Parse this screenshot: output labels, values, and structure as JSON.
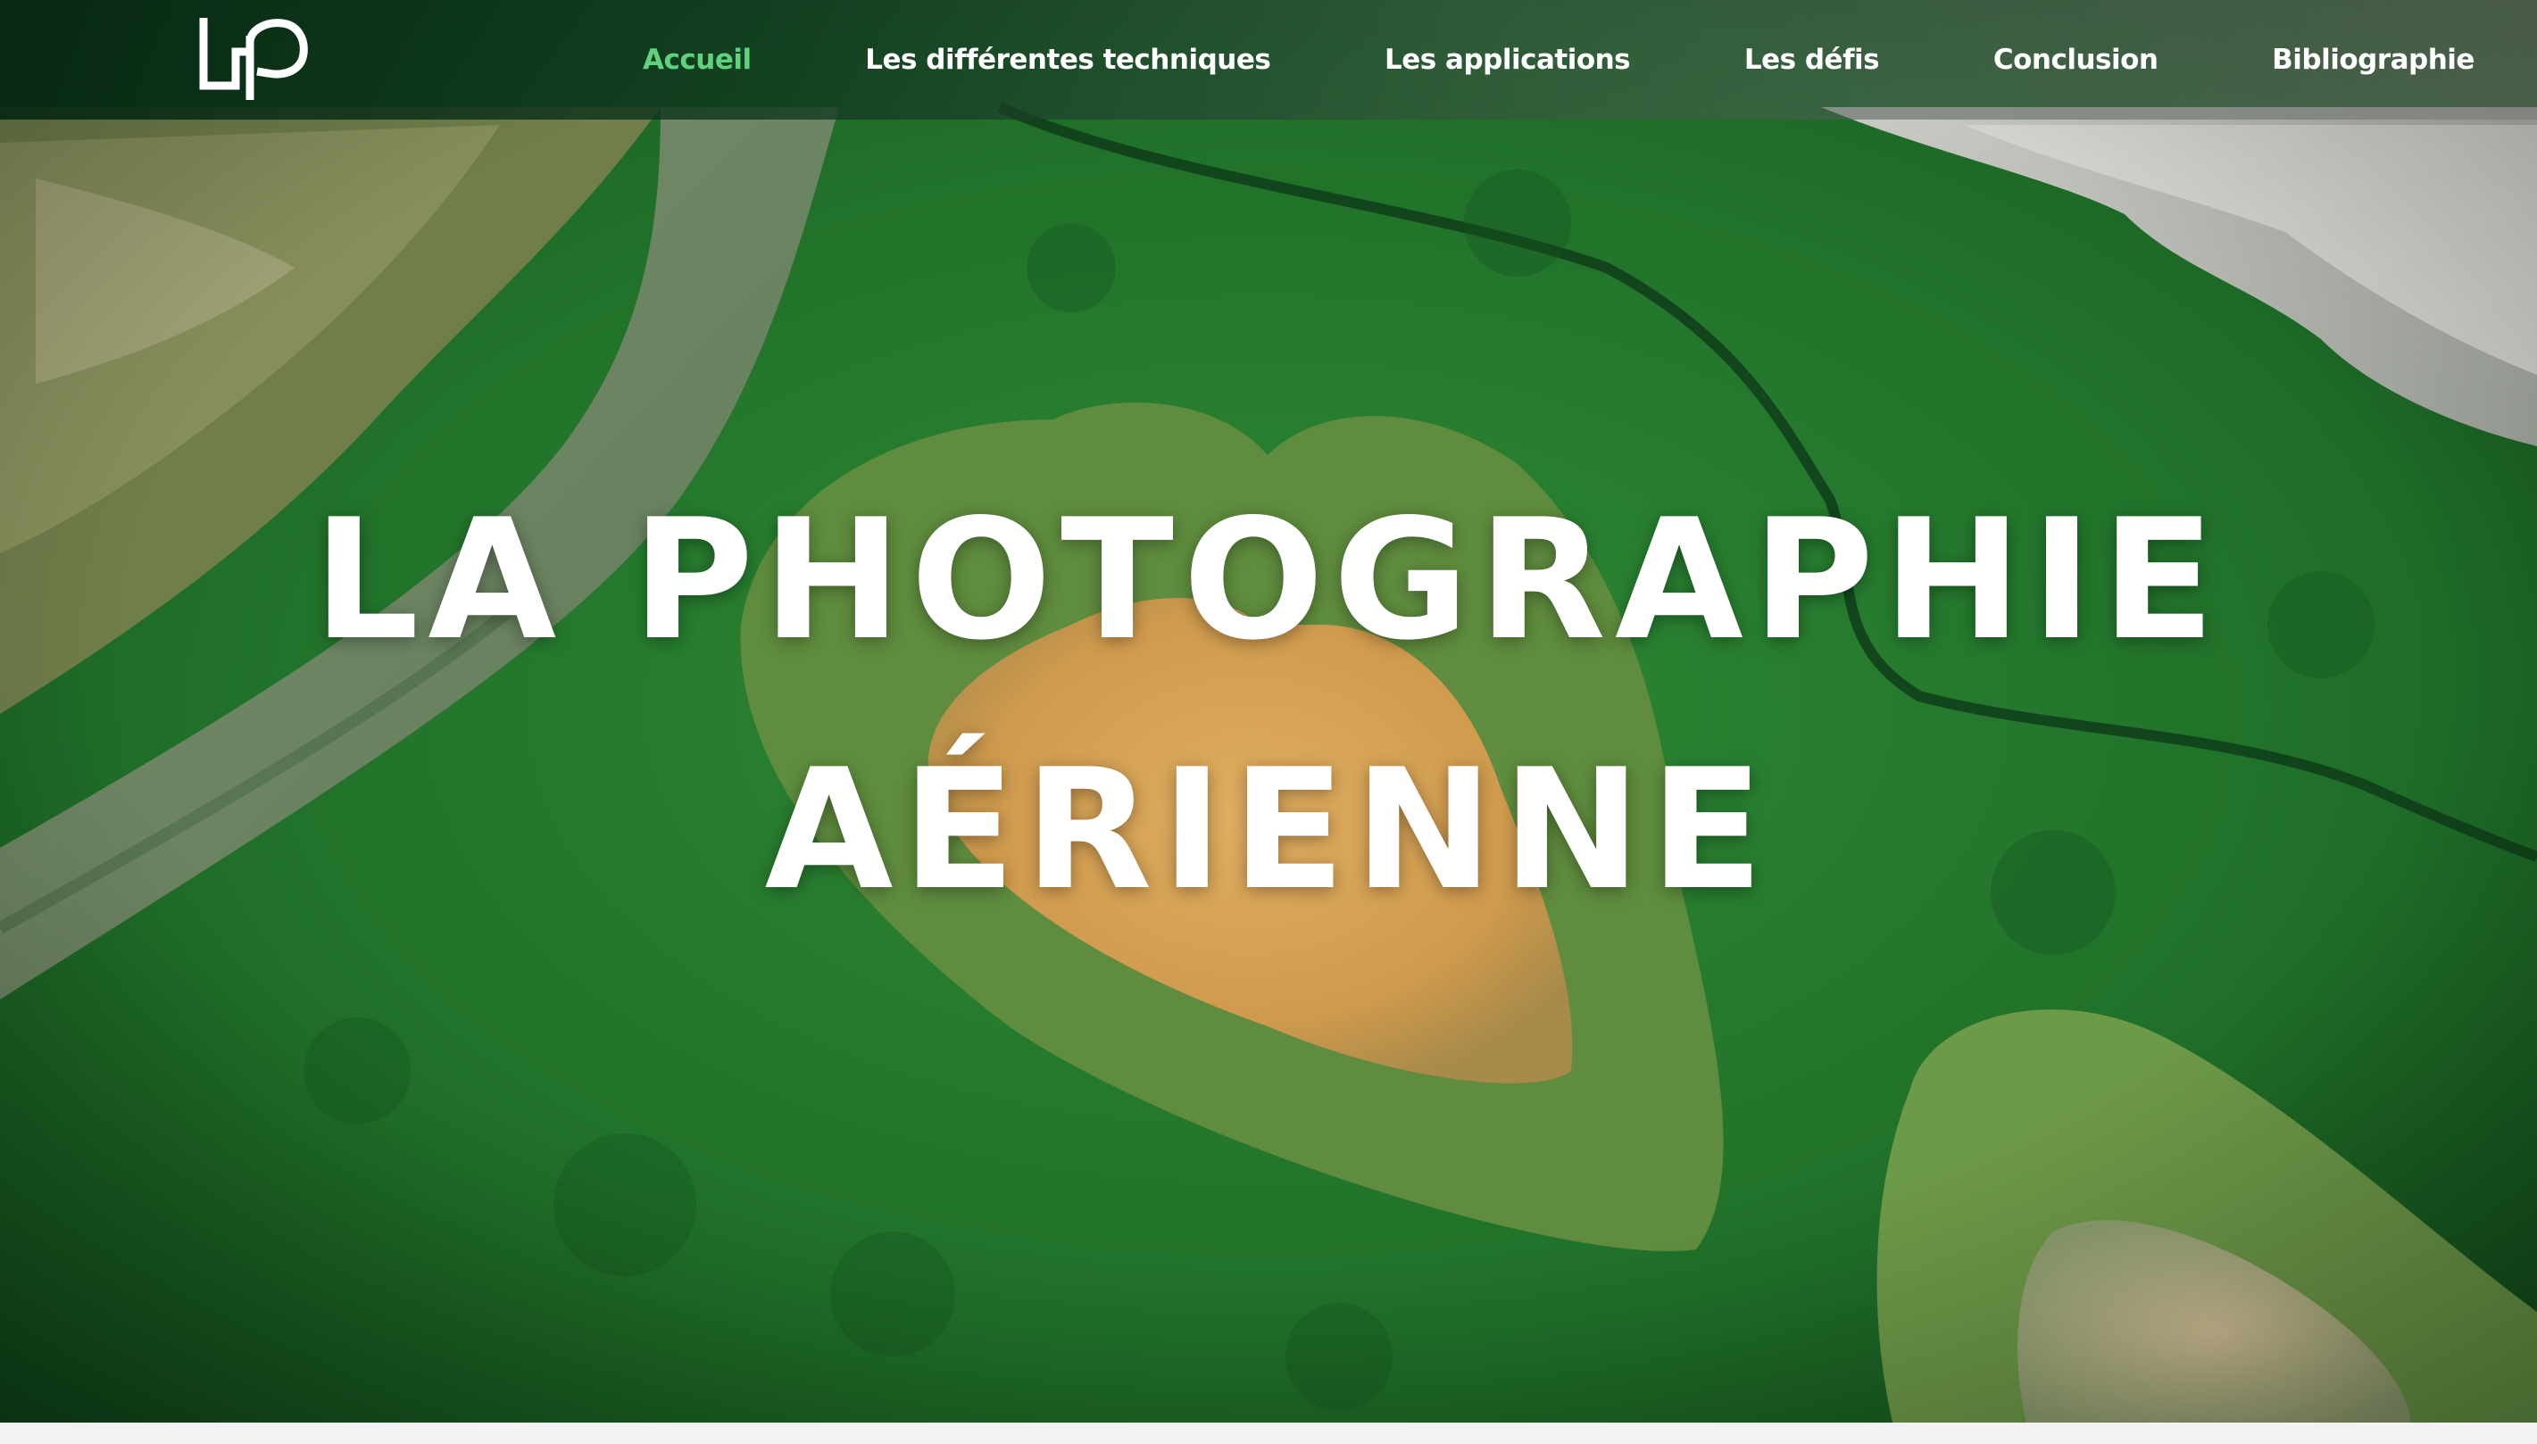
{
  "brand": {
    "logo_icon": "lip-logo-icon",
    "logo_text": "LiP"
  },
  "nav": {
    "items": [
      {
        "label": "Accueil",
        "active": true
      },
      {
        "label": "Les différentes techniques",
        "active": false
      },
      {
        "label": "Les applications",
        "active": false
      },
      {
        "label": "Les défis",
        "active": false
      },
      {
        "label": "Conclusion",
        "active": false
      },
      {
        "label": "Bibliographie",
        "active": false
      }
    ]
  },
  "hero": {
    "title_line1": "LA PHOTOGRAPHIE",
    "title_line2": "AÉRIENNE",
    "background_image": "aerial-mangrove-heart-photo"
  },
  "colors": {
    "accent": "#5fd17f",
    "text": "#ffffff",
    "forest": "#1f6b2a",
    "heart_sand": "#d9a55a"
  }
}
